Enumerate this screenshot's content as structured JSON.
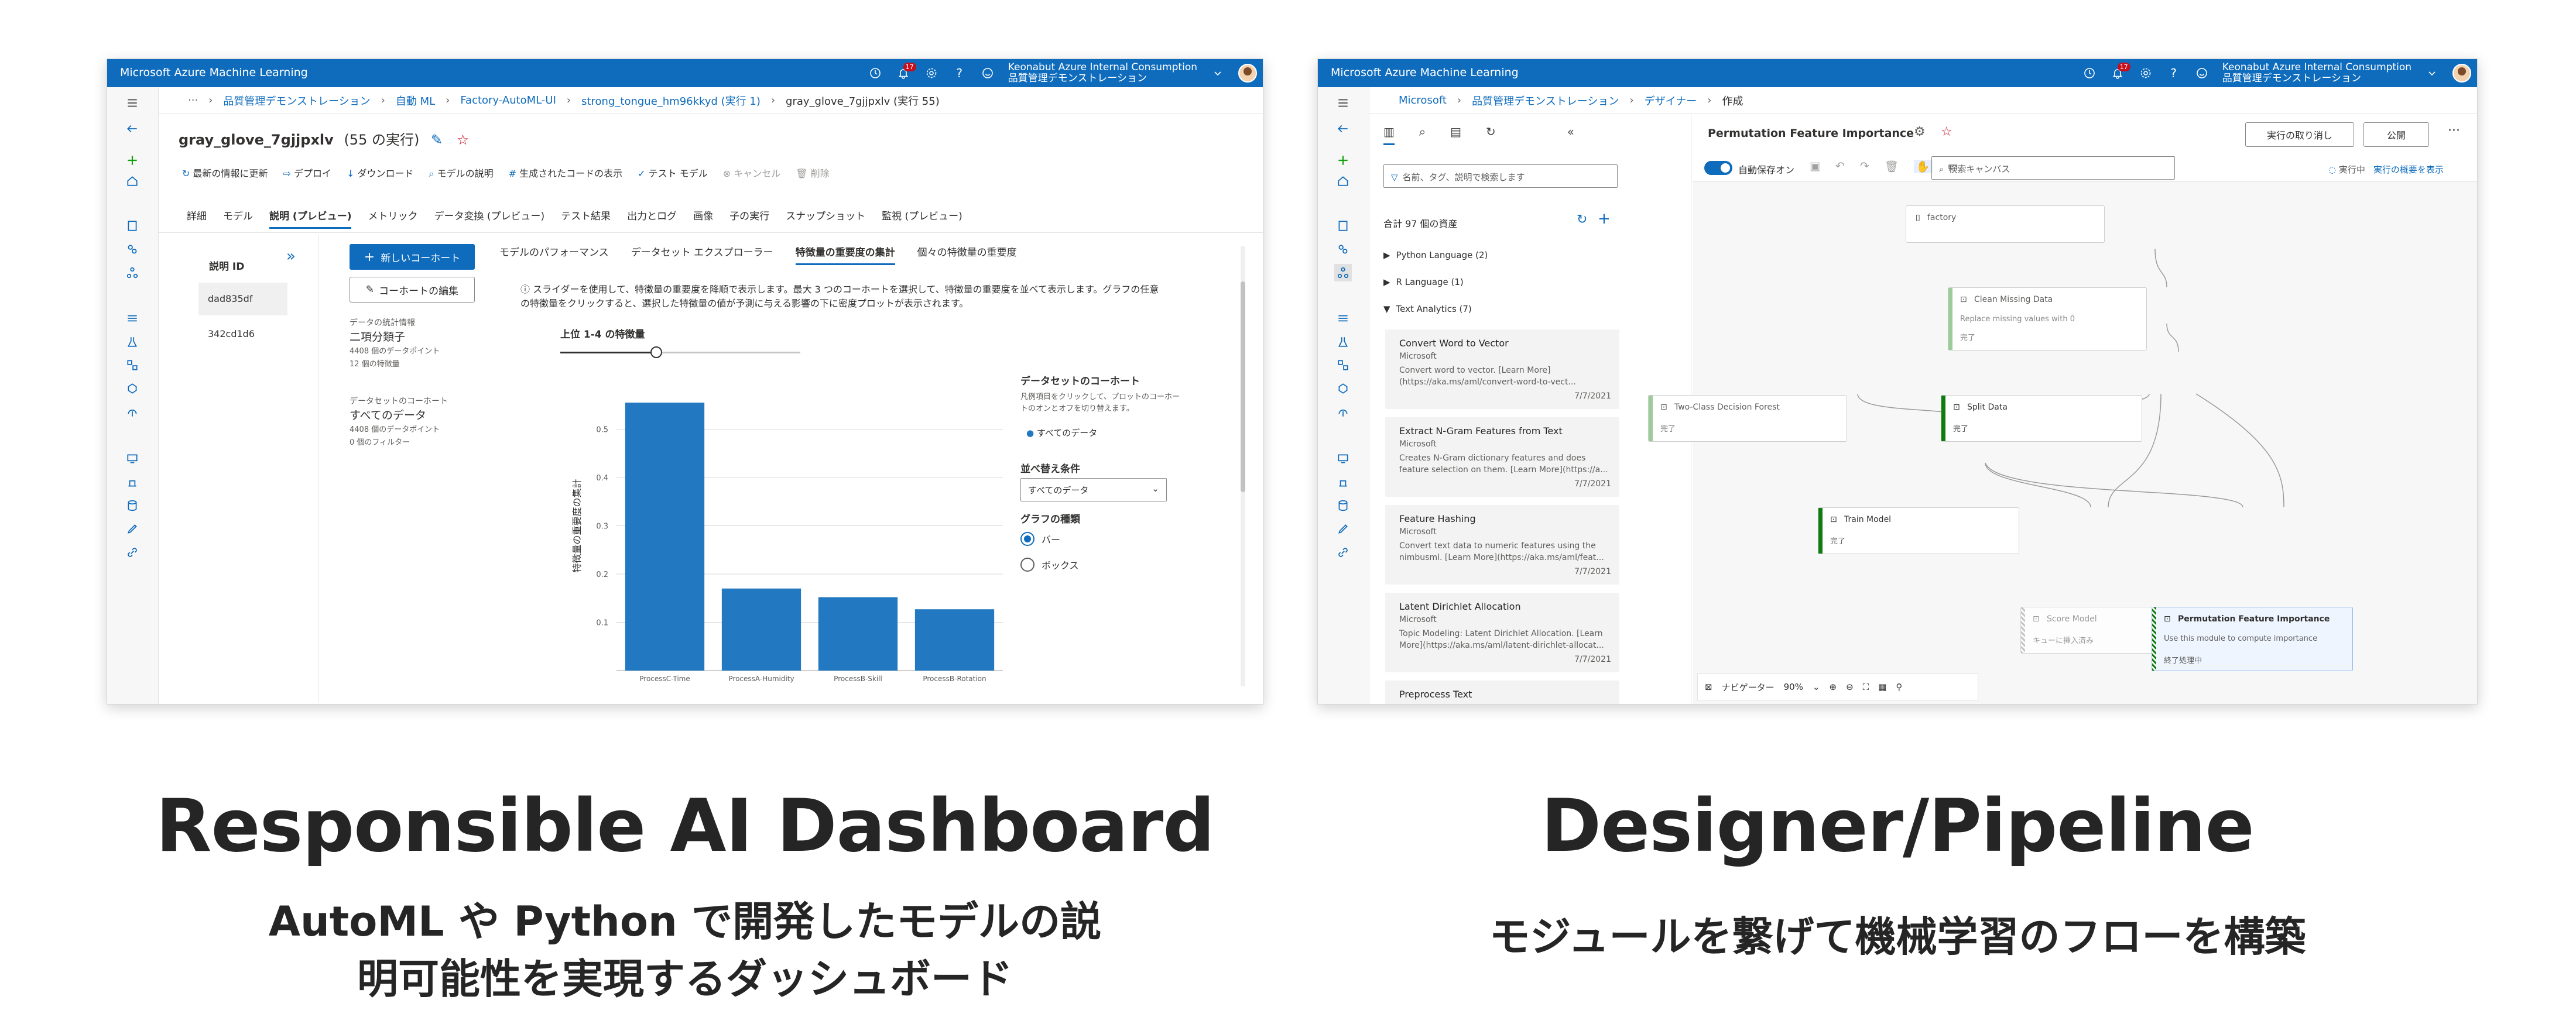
{
  "left": {
    "window_title": "Microsoft Azure Machine Learning",
    "account": {
      "line1": "Keonabut Azure Internal Consumption",
      "line2": "品質管理デモンストレーション"
    },
    "notifications": "17",
    "breadcrumb": [
      "品質管理デモンストレーション",
      "自動 ML",
      "Factory-AutoML-UI",
      "strong_tongue_hm96kkyd (実行 1)",
      "gray_glove_7gjjpxlv (実行 55)"
    ],
    "run_title": "gray_glove_7gjjpxlv",
    "run_count": "(55 の実行)",
    "toolbar": [
      "最新の情報に更新",
      "デプロイ",
      "ダウンロード",
      "モデルの説明",
      "生成されたコードの表示",
      "テスト モデル",
      "キャンセル",
      "削除"
    ],
    "tabs": [
      "詳細",
      "モデル",
      "説明 (プレビュー)",
      "メトリック",
      "データ変換 (プレビュー)",
      "テスト結果",
      "出力とログ",
      "画像",
      "子の実行",
      "スナップショット",
      "監視 (プレビュー)"
    ],
    "explain_id_header": "説明 ID",
    "explain_ids": [
      "dad835df",
      "342cd1d6"
    ],
    "new_cohort": "新しいコーホート",
    "edit_cohort": "コーホートの編集",
    "stats_label": "データの統計情報",
    "stats_name": "二項分類子",
    "stats_points": "4408 個のデータポイント",
    "stats_features": "12 個の特徴量",
    "cohort_label": "データセットのコーホート",
    "cohort_name": "すべてのデータ",
    "cohort_points": "4408 個のデータポイント",
    "cohort_filters": "0 個のフィルター",
    "subtabs": [
      "モデルのパフォーマンス",
      "データセット エクスプローラー",
      "特徴量の重要度の集計",
      "個々の特徴量の重要度"
    ],
    "info_line1": "ⓘ スライダーを使用して、特徴量の重要度を降順で表示します。最大 3 つのコーホートを選択して、特徴量の重要度を並べて表示します。グラフの任意",
    "info_line2": "の特徴量をクリックすると、選択した特徴量の値が予測に与える影響の下に密度プロットが表示されます。",
    "slider_label": "上位 1-4 の特徴量",
    "slider_value": 0.4,
    "legend_title": "データセットのコーホート",
    "legend_desc1": "凡例項目をクリックして、プロットのコーホー",
    "legend_desc2": "トのオンとオフを切り替えます。",
    "legend_item": "すべてのデータ",
    "sort_label": "並べ替え条件",
    "sort_value": "すべてのデータ",
    "graph_type_label": "グラフの種類",
    "graph_types": [
      "バー",
      "ボックス"
    ],
    "accent": "#2278c1"
  },
  "chart_data": {
    "type": "bar",
    "categories": [
      "ProcessC-Time",
      "ProcessA-Humidity",
      "ProcessB-Skill",
      "ProcessB-Rotation"
    ],
    "values": [
      0.555,
      0.17,
      0.152,
      0.127
    ],
    "ylabel": "特徴量の重要度の集計",
    "yticks": [
      "0.5",
      "0.4",
      "0.3",
      "0.2",
      "0.1"
    ],
    "ylim": [
      0,
      0.6
    ]
  },
  "right": {
    "window_title": "Microsoft Azure Machine Learning",
    "account": {
      "line1": "Keonabut Azure Internal Consumption",
      "line2": "品質管理デモンストレーション"
    },
    "notifications": "17",
    "breadcrumb": [
      "Microsoft",
      "品質管理デモンストレーション",
      "デザイナー",
      "作成"
    ],
    "pipeline_title": "Permutation Feature Importance",
    "cancel_run": "実行の取り消し",
    "publish": "公開",
    "search_placeholder": "名前、タグ、説明で検索します",
    "autosave": "自動保存オン",
    "canvas_search": "検索キャンバス",
    "running": "実行中",
    "run_summary": "実行の概要を表示",
    "asset_total": "合計 97 個の資産",
    "categories": [
      "Python Language (2)",
      "R Language (1)",
      "Text Analytics (7)"
    ],
    "assets": [
      {
        "title": "Convert Word to Vector",
        "publisher": "Microsoft",
        "desc": "Convert word to vector. [Learn More](https://aka.ms/aml/convert-word-to-vect...",
        "date": "7/7/2021"
      },
      {
        "title": "Extract N-Gram Features from Text",
        "publisher": "Microsoft",
        "desc": "Creates N-Gram dictionary features and does feature selection on them. [Learn More](https://a...",
        "date": "7/7/2021"
      },
      {
        "title": "Feature Hashing",
        "publisher": "Microsoft",
        "desc": "Convert text data to numeric features using the nimbusml. [Learn More](https://aka.ms/aml/feat...",
        "date": "7/7/2021"
      },
      {
        "title": "Latent Dirichlet Allocation",
        "publisher": "Microsoft",
        "desc": "Topic Modeling: Latent Dirichlet Allocation. [Learn More](https://aka.ms/aml/latent-dirichlet-allocat...",
        "date": "7/7/2021"
      },
      {
        "title": "Preprocess Text",
        "publisher": "",
        "desc": "",
        "date": ""
      }
    ],
    "nodes": {
      "factory": "factory",
      "clean": "Clean Missing Data",
      "clean_desc": "Replace missing values with 0",
      "clean_status": "完了",
      "two_class": "Two-Class Decision Forest",
      "two_class_status": "完了",
      "split": "Split Data",
      "split_status": "完了",
      "train": "Train Model",
      "train_status": "完了",
      "score": "Score Model",
      "score_status": "キューに挿入済み",
      "pfi": "Permutation Feature Importance",
      "pfi_desc": "Use this module to compute importance",
      "pfi_status": "終了処理中"
    },
    "navigator": "ナビゲーター",
    "zoom": "90%"
  },
  "captions": {
    "left_title": "Responsible AI Dashboard",
    "left_sub1": "AutoML や Python で開発したモデルの説",
    "left_sub2": "明可能性を実現するダッシュボード",
    "right_title": "Designer/Pipeline",
    "right_sub": "モジュールを繋げて機械学習のフローを構築"
  }
}
